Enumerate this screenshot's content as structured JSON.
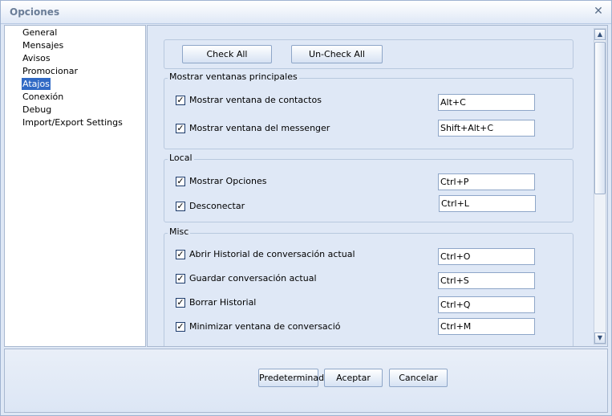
{
  "window": {
    "title": "Opciones"
  },
  "nav": {
    "items": [
      "General",
      "Mensajes",
      "Avisos",
      "Promocionar",
      "Atajos",
      "Conexión",
      "Debug",
      "Import/Export Settings"
    ]
  },
  "toolbar": {
    "check_all": "Check All",
    "uncheck_all": "Un-Check All"
  },
  "groups": {
    "main": {
      "label": "Mostrar ventanas principales",
      "rows": [
        {
          "label": "Mostrar ventana de contactos",
          "shortcut": "Alt+C",
          "checked": true
        },
        {
          "label": "Mostrar ventana del messenger",
          "shortcut": "Shift+Alt+C",
          "checked": true
        }
      ]
    },
    "local": {
      "label": "Local",
      "rows": [
        {
          "label": "Mostrar Opciones",
          "shortcut": "Ctrl+P",
          "checked": true
        },
        {
          "label": "Desconectar",
          "shortcut": "Ctrl+L",
          "checked": true
        }
      ]
    },
    "misc": {
      "label": "Misc",
      "rows": [
        {
          "label": "Abrir Historial de conversación actual",
          "shortcut": "Ctrl+O",
          "checked": true
        },
        {
          "label": "Guardar conversación actual",
          "shortcut": "Ctrl+S",
          "checked": true
        },
        {
          "label": "Borrar Historial",
          "shortcut": "Ctrl+Q",
          "checked": true
        },
        {
          "label": "Minimizar ventana de conversació",
          "shortcut": "Ctrl+M",
          "checked": true
        }
      ]
    }
  },
  "footer": {
    "default_label": "Predeterminado",
    "accept_label": "Aceptar",
    "cancel_label": "Cancelar"
  },
  "icons": {
    "close": "close-icon",
    "check": "checkmark-icon",
    "scroll_up": "arrow-up-icon",
    "scroll_down": "arrow-down-icon"
  },
  "colors": {
    "selection": "#316ac5",
    "panel": "#dfe8f6",
    "border": "#a8b8d0"
  }
}
